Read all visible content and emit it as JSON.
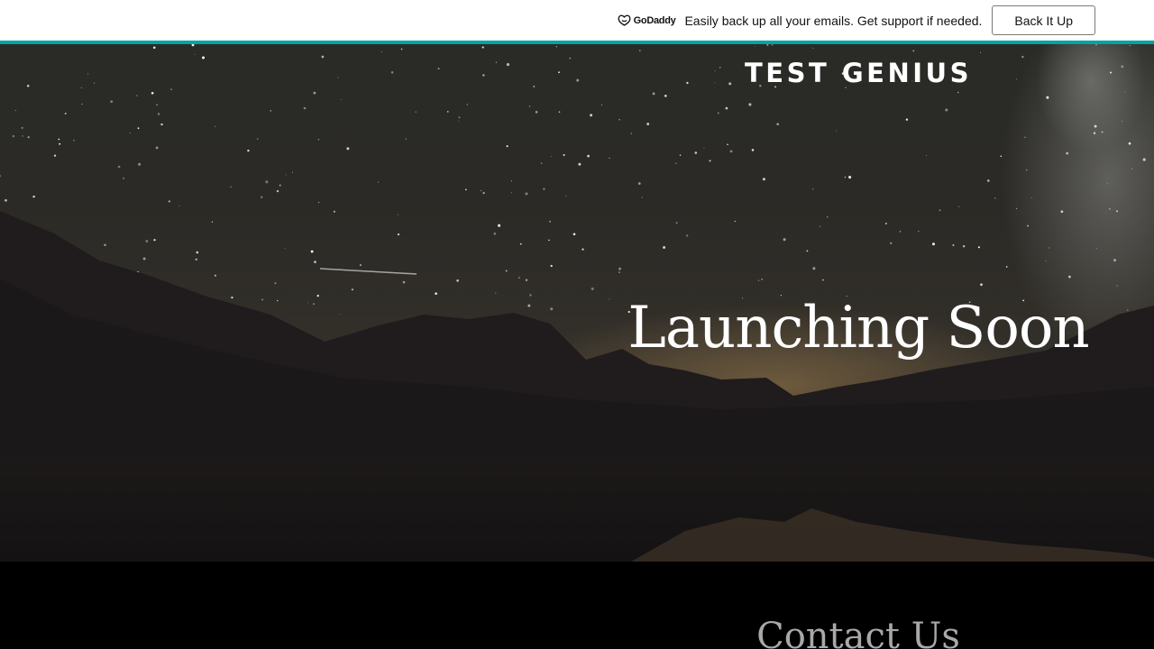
{
  "banner": {
    "brand_name": "GoDaddy",
    "brand_icon": "godaddy-logo-icon",
    "message": "Easily back up all your emails. Get support if needed.",
    "button_label": "Back It Up",
    "accent_color": "#00a4a6"
  },
  "hero": {
    "site_title": "TEST GENIUS",
    "heading": "Launching Soon",
    "background": "night sky over mountains and lake"
  },
  "contact": {
    "heading": "Contact Us"
  }
}
